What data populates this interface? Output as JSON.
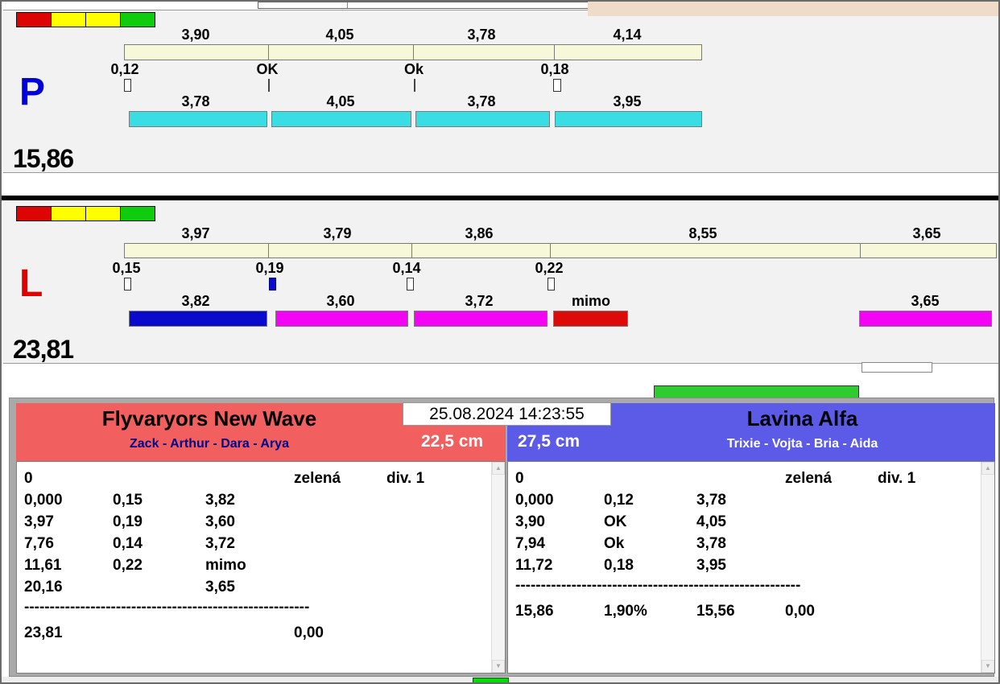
{
  "colors": {
    "light-red": "#dd0404",
    "light-yellow": "#ffff00",
    "light-green": "#0fcc0f",
    "cream-bar": "#f7f7da",
    "cyan-bar": "#3adde4",
    "blue-bar": "#0a0acc",
    "magenta-bar": "#f404f4",
    "red-bar": "#dd0a0a",
    "green-bar": "#2ecc2e",
    "team-left": "#f25f5f",
    "team-right": "#5b5be8",
    "p-letter": "#0000dd",
    "l-letter": "#e00000",
    "members-left": "#00008b",
    "desktop-corner": "#eedcc9"
  },
  "lane_p": {
    "label": "P",
    "total": "15,86",
    "top_values": [
      "3,90",
      "4,05",
      "3,78",
      "4,14"
    ],
    "mid_labels": [
      "0,12",
      "OK",
      "Ok",
      "0,18"
    ],
    "bottom_values": [
      "3,78",
      "4,05",
      "3,78",
      "3,95"
    ]
  },
  "lane_l": {
    "label": "L",
    "total": "23,81",
    "top_values": [
      "3,97",
      "3,79",
      "3,86",
      "8,55",
      "3,65"
    ],
    "mid_labels": [
      "0,15",
      "0,19",
      "0,14",
      "0,22"
    ],
    "bottom_values": [
      "3,82",
      "3,60",
      "3,72",
      "mimo",
      "3,65"
    ]
  },
  "race": {
    "datetime": "25.08.2024 14:23:55"
  },
  "team_left": {
    "name": "Flyvaryors New Wave",
    "members": "Zack - Arthur - Dara - Arya",
    "jump_height": "22,5 cm",
    "list": {
      "header": {
        "c1": "0",
        "c4": "zelená",
        "c5": "div. 1"
      },
      "rows": [
        [
          "0,000",
          "0,15",
          "3,82"
        ],
        [
          "3,97",
          "0,19",
          "3,60"
        ],
        [
          "7,76",
          "0,14",
          "3,72"
        ],
        [
          "11,61",
          "0,22",
          "mimo"
        ],
        [
          "20,16",
          "",
          "3,65"
        ]
      ],
      "separator": "--------------------------------------------------------",
      "total": {
        "c1": "23,81",
        "c2": "",
        "c3": "",
        "c4": "0,00"
      }
    }
  },
  "team_right": {
    "name": "Lavina Alfa",
    "members": "Trixie - Vojta - Bria - Aida",
    "jump_height": "27,5 cm",
    "list": {
      "header": {
        "c1": "0",
        "c4": "zelená",
        "c5": "div. 1"
      },
      "rows": [
        [
          "0,000",
          "0,12",
          "3,78"
        ],
        [
          "3,90",
          "OK",
          "4,05"
        ],
        [
          "7,94",
          "Ok",
          "3,78"
        ],
        [
          "11,72",
          "0,18",
          "3,95"
        ]
      ],
      "separator": "--------------------------------------------------------",
      "total": {
        "c1": "15,86",
        "c2": "1,90%",
        "c3": "15,56",
        "c4": "0,00"
      }
    }
  },
  "scrollbar": {
    "up": "▲",
    "down": "▼"
  }
}
